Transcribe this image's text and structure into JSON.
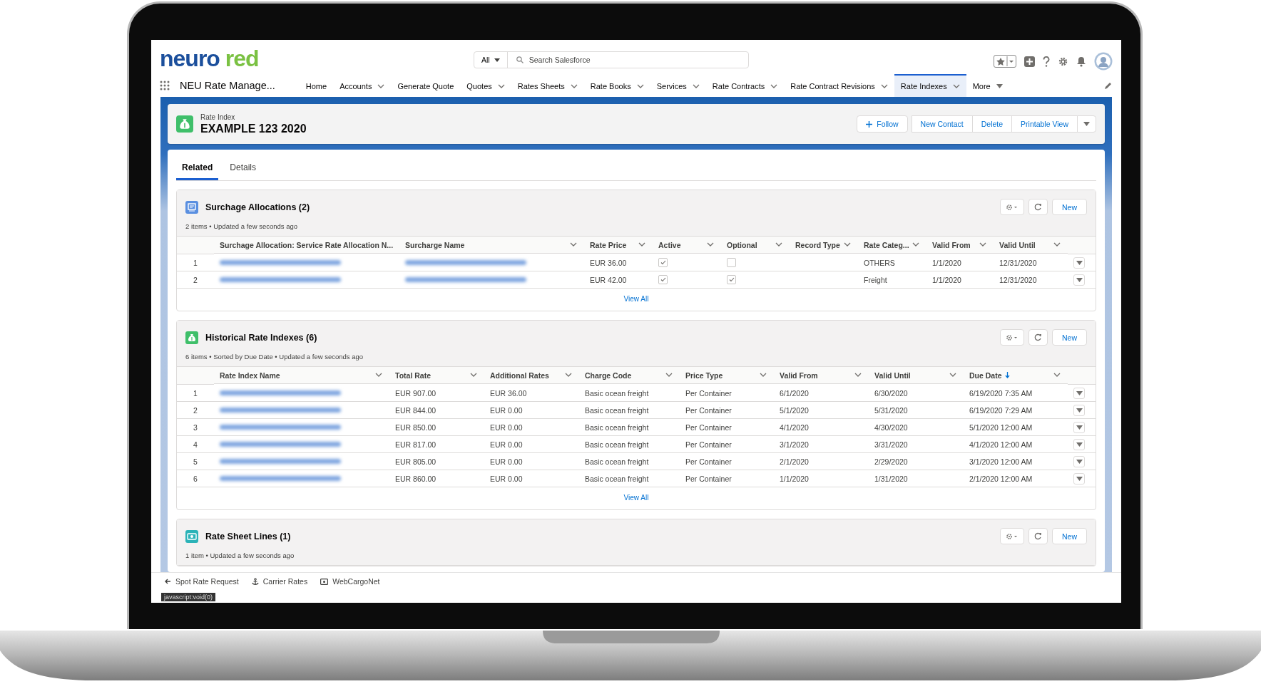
{
  "logo": {
    "text": "neuro red"
  },
  "search": {
    "scope": "All",
    "placeholder": "Search Salesforce"
  },
  "app_name": "NEU Rate Manage...",
  "nav": [
    {
      "label": "Home",
      "kind": "plain",
      "selected": false
    },
    {
      "label": "Accounts",
      "kind": "menu",
      "selected": false
    },
    {
      "label": "Generate Quote",
      "kind": "plain",
      "selected": false
    },
    {
      "label": "Quotes",
      "kind": "menu",
      "selected": false
    },
    {
      "label": "Rates Sheets",
      "kind": "menu",
      "selected": false
    },
    {
      "label": "Rate Books",
      "kind": "menu",
      "selected": false
    },
    {
      "label": "Services",
      "kind": "menu",
      "selected": false
    },
    {
      "label": "Rate Contracts",
      "kind": "menu",
      "selected": false
    },
    {
      "label": "Rate Contract Revisions",
      "kind": "menu",
      "selected": false
    },
    {
      "label": "Rate Indexes",
      "kind": "menu",
      "selected": true
    },
    {
      "label": "More",
      "kind": "more",
      "selected": false
    }
  ],
  "record": {
    "object": "Rate Index",
    "name": "EXAMPLE 123 2020",
    "actions": [
      {
        "label": "Follow",
        "kind": "add"
      },
      {
        "label": "New Contact",
        "kind": "plain"
      },
      {
        "label": "Delete",
        "kind": "plain"
      },
      {
        "label": "Printable View",
        "kind": "plain"
      }
    ]
  },
  "tabs": [
    {
      "label": "Related",
      "selected": true
    },
    {
      "label": "Details",
      "selected": false
    }
  ],
  "related_lists": [
    {
      "title": "Surchage Allocations (2)",
      "kind": "list",
      "color": "#5a8fe0",
      "summary": "2 items • Updated a few seconds ago",
      "new_label": "New",
      "footer": "View All",
      "columns": [
        {
          "label": "Surchage Allocation: Service Rate Allocation N...",
          "sorted": false
        },
        {
          "label": "Surcharge Name",
          "sorted": false
        },
        {
          "label": "Rate Price",
          "sorted": false
        },
        {
          "label": "Active",
          "sorted": false
        },
        {
          "label": "Optional",
          "sorted": false
        },
        {
          "label": "Record Type",
          "sorted": false
        },
        {
          "label": "Rate Categ...",
          "sorted": false
        },
        {
          "label": "Valid From",
          "sorted": false
        },
        {
          "label": "Valid Until",
          "sorted": false
        }
      ],
      "rows": [
        {
          "num": "1",
          "cells": [
            {
              "kind": "redacted"
            },
            {
              "kind": "redacted"
            },
            {
              "kind": "text",
              "text": "EUR 36.00"
            },
            {
              "kind": "checkbox",
              "checked": true
            },
            {
              "kind": "checkbox",
              "checked": false
            },
            {
              "kind": "empty"
            },
            {
              "kind": "text",
              "text": "OTHERS"
            },
            {
              "kind": "text",
              "text": "1/1/2020"
            },
            {
              "kind": "text",
              "text": "12/31/2020"
            }
          ]
        },
        {
          "num": "2",
          "cells": [
            {
              "kind": "redacted"
            },
            {
              "kind": "redacted"
            },
            {
              "kind": "text",
              "text": "EUR 42.00"
            },
            {
              "kind": "checkbox",
              "checked": true
            },
            {
              "kind": "checkbox",
              "checked": true
            },
            {
              "kind": "empty"
            },
            {
              "kind": "text",
              "text": "Freight"
            },
            {
              "kind": "text",
              "text": "1/1/2020"
            },
            {
              "kind": "text",
              "text": "12/31/2020"
            }
          ]
        }
      ]
    },
    {
      "title": "Historical Rate Indexes (6)",
      "kind": "money",
      "color": "#3fbf6a",
      "summary": "6 items • Sorted by Due Date • Updated a few seconds ago",
      "new_label": "New",
      "footer": "View All",
      "columns": [
        {
          "label": "Rate Index Name",
          "sorted": false
        },
        {
          "label": "Total Rate",
          "sorted": false
        },
        {
          "label": "Additional Rates",
          "sorted": false
        },
        {
          "label": "Charge Code",
          "sorted": false
        },
        {
          "label": "Price Type",
          "sorted": false
        },
        {
          "label": "Valid From",
          "sorted": false
        },
        {
          "label": "Valid Until",
          "sorted": false
        },
        {
          "label": "Due Date",
          "sorted": true
        }
      ],
      "rows": [
        {
          "num": "1",
          "cells": [
            {
              "kind": "redacted"
            },
            {
              "kind": "text",
              "text": "EUR 907.00"
            },
            {
              "kind": "text",
              "text": "EUR 36.00"
            },
            {
              "kind": "text",
              "text": "Basic ocean freight"
            },
            {
              "kind": "text",
              "text": "Per Container"
            },
            {
              "kind": "text",
              "text": "6/1/2020"
            },
            {
              "kind": "text",
              "text": "6/30/2020"
            },
            {
              "kind": "text",
              "text": "6/19/2020 7:35 AM"
            }
          ]
        },
        {
          "num": "2",
          "cells": [
            {
              "kind": "redacted"
            },
            {
              "kind": "text",
              "text": "EUR 844.00"
            },
            {
              "kind": "text",
              "text": "EUR 0.00"
            },
            {
              "kind": "text",
              "text": "Basic ocean freight"
            },
            {
              "kind": "text",
              "text": "Per Container"
            },
            {
              "kind": "text",
              "text": "5/1/2020"
            },
            {
              "kind": "text",
              "text": "5/31/2020"
            },
            {
              "kind": "text",
              "text": "6/19/2020 7:29 AM"
            }
          ]
        },
        {
          "num": "3",
          "cells": [
            {
              "kind": "redacted"
            },
            {
              "kind": "text",
              "text": "EUR 850.00"
            },
            {
              "kind": "text",
              "text": "EUR 0.00"
            },
            {
              "kind": "text",
              "text": "Basic ocean freight"
            },
            {
              "kind": "text",
              "text": "Per Container"
            },
            {
              "kind": "text",
              "text": "4/1/2020"
            },
            {
              "kind": "text",
              "text": "4/30/2020"
            },
            {
              "kind": "text",
              "text": "5/1/2020 12:00 AM"
            }
          ]
        },
        {
          "num": "4",
          "cells": [
            {
              "kind": "redacted"
            },
            {
              "kind": "text",
              "text": "EUR 817.00"
            },
            {
              "kind": "text",
              "text": "EUR 0.00"
            },
            {
              "kind": "text",
              "text": "Basic ocean freight"
            },
            {
              "kind": "text",
              "text": "Per Container"
            },
            {
              "kind": "text",
              "text": "3/1/2020"
            },
            {
              "kind": "text",
              "text": "3/31/2020"
            },
            {
              "kind": "text",
              "text": "4/1/2020 12:00 AM"
            }
          ]
        },
        {
          "num": "5",
          "cells": [
            {
              "kind": "redacted"
            },
            {
              "kind": "text",
              "text": "EUR 805.00"
            },
            {
              "kind": "text",
              "text": "EUR 0.00"
            },
            {
              "kind": "text",
              "text": "Basic ocean freight"
            },
            {
              "kind": "text",
              "text": "Per Container"
            },
            {
              "kind": "text",
              "text": "2/1/2020"
            },
            {
              "kind": "text",
              "text": "2/29/2020"
            },
            {
              "kind": "text",
              "text": "3/1/2020 12:00 AM"
            }
          ]
        },
        {
          "num": "6",
          "cells": [
            {
              "kind": "redacted"
            },
            {
              "kind": "text",
              "text": "EUR 860.00"
            },
            {
              "kind": "text",
              "text": "EUR 0.00"
            },
            {
              "kind": "text",
              "text": "Basic ocean freight"
            },
            {
              "kind": "text",
              "text": "Per Container"
            },
            {
              "kind": "text",
              "text": "1/1/2020"
            },
            {
              "kind": "text",
              "text": "1/31/2020"
            },
            {
              "kind": "text",
              "text": "2/1/2020 12:00 AM"
            }
          ]
        }
      ]
    },
    {
      "title": "Rate Sheet Lines (1)",
      "kind": "sheet",
      "color": "#2bb3b8",
      "summary": "1 item • Updated a few seconds ago",
      "new_label": "New"
    }
  ],
  "utility_bar": [
    {
      "label": "Spot Rate Request",
      "kind": "arrow"
    },
    {
      "label": "Carrier Rates",
      "kind": "anchor"
    },
    {
      "label": "WebCargoNet",
      "kind": "screen"
    }
  ],
  "status_tooltip": "javascript:void(0)"
}
